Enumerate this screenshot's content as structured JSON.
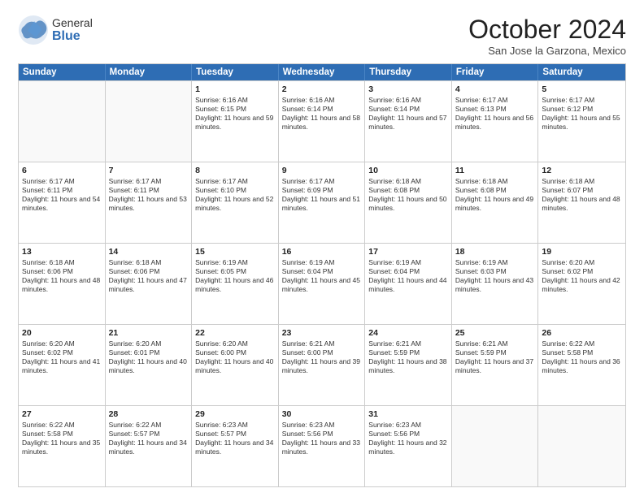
{
  "logo": {
    "general": "General",
    "blue": "Blue",
    "tagline": ""
  },
  "header": {
    "month": "October 2024",
    "location": "San Jose la Garzona, Mexico"
  },
  "days": [
    "Sunday",
    "Monday",
    "Tuesday",
    "Wednesday",
    "Thursday",
    "Friday",
    "Saturday"
  ],
  "weeks": [
    [
      {
        "day": "",
        "info": ""
      },
      {
        "day": "",
        "info": ""
      },
      {
        "day": "1",
        "info": "Sunrise: 6:16 AM\nSunset: 6:15 PM\nDaylight: 11 hours and 59 minutes."
      },
      {
        "day": "2",
        "info": "Sunrise: 6:16 AM\nSunset: 6:14 PM\nDaylight: 11 hours and 58 minutes."
      },
      {
        "day": "3",
        "info": "Sunrise: 6:16 AM\nSunset: 6:14 PM\nDaylight: 11 hours and 57 minutes."
      },
      {
        "day": "4",
        "info": "Sunrise: 6:17 AM\nSunset: 6:13 PM\nDaylight: 11 hours and 56 minutes."
      },
      {
        "day": "5",
        "info": "Sunrise: 6:17 AM\nSunset: 6:12 PM\nDaylight: 11 hours and 55 minutes."
      }
    ],
    [
      {
        "day": "6",
        "info": "Sunrise: 6:17 AM\nSunset: 6:11 PM\nDaylight: 11 hours and 54 minutes."
      },
      {
        "day": "7",
        "info": "Sunrise: 6:17 AM\nSunset: 6:11 PM\nDaylight: 11 hours and 53 minutes."
      },
      {
        "day": "8",
        "info": "Sunrise: 6:17 AM\nSunset: 6:10 PM\nDaylight: 11 hours and 52 minutes."
      },
      {
        "day": "9",
        "info": "Sunrise: 6:17 AM\nSunset: 6:09 PM\nDaylight: 11 hours and 51 minutes."
      },
      {
        "day": "10",
        "info": "Sunrise: 6:18 AM\nSunset: 6:08 PM\nDaylight: 11 hours and 50 minutes."
      },
      {
        "day": "11",
        "info": "Sunrise: 6:18 AM\nSunset: 6:08 PM\nDaylight: 11 hours and 49 minutes."
      },
      {
        "day": "12",
        "info": "Sunrise: 6:18 AM\nSunset: 6:07 PM\nDaylight: 11 hours and 48 minutes."
      }
    ],
    [
      {
        "day": "13",
        "info": "Sunrise: 6:18 AM\nSunset: 6:06 PM\nDaylight: 11 hours and 48 minutes."
      },
      {
        "day": "14",
        "info": "Sunrise: 6:18 AM\nSunset: 6:06 PM\nDaylight: 11 hours and 47 minutes."
      },
      {
        "day": "15",
        "info": "Sunrise: 6:19 AM\nSunset: 6:05 PM\nDaylight: 11 hours and 46 minutes."
      },
      {
        "day": "16",
        "info": "Sunrise: 6:19 AM\nSunset: 6:04 PM\nDaylight: 11 hours and 45 minutes."
      },
      {
        "day": "17",
        "info": "Sunrise: 6:19 AM\nSunset: 6:04 PM\nDaylight: 11 hours and 44 minutes."
      },
      {
        "day": "18",
        "info": "Sunrise: 6:19 AM\nSunset: 6:03 PM\nDaylight: 11 hours and 43 minutes."
      },
      {
        "day": "19",
        "info": "Sunrise: 6:20 AM\nSunset: 6:02 PM\nDaylight: 11 hours and 42 minutes."
      }
    ],
    [
      {
        "day": "20",
        "info": "Sunrise: 6:20 AM\nSunset: 6:02 PM\nDaylight: 11 hours and 41 minutes."
      },
      {
        "day": "21",
        "info": "Sunrise: 6:20 AM\nSunset: 6:01 PM\nDaylight: 11 hours and 40 minutes."
      },
      {
        "day": "22",
        "info": "Sunrise: 6:20 AM\nSunset: 6:00 PM\nDaylight: 11 hours and 40 minutes."
      },
      {
        "day": "23",
        "info": "Sunrise: 6:21 AM\nSunset: 6:00 PM\nDaylight: 11 hours and 39 minutes."
      },
      {
        "day": "24",
        "info": "Sunrise: 6:21 AM\nSunset: 5:59 PM\nDaylight: 11 hours and 38 minutes."
      },
      {
        "day": "25",
        "info": "Sunrise: 6:21 AM\nSunset: 5:59 PM\nDaylight: 11 hours and 37 minutes."
      },
      {
        "day": "26",
        "info": "Sunrise: 6:22 AM\nSunset: 5:58 PM\nDaylight: 11 hours and 36 minutes."
      }
    ],
    [
      {
        "day": "27",
        "info": "Sunrise: 6:22 AM\nSunset: 5:58 PM\nDaylight: 11 hours and 35 minutes."
      },
      {
        "day": "28",
        "info": "Sunrise: 6:22 AM\nSunset: 5:57 PM\nDaylight: 11 hours and 34 minutes."
      },
      {
        "day": "29",
        "info": "Sunrise: 6:23 AM\nSunset: 5:57 PM\nDaylight: 11 hours and 34 minutes."
      },
      {
        "day": "30",
        "info": "Sunrise: 6:23 AM\nSunset: 5:56 PM\nDaylight: 11 hours and 33 minutes."
      },
      {
        "day": "31",
        "info": "Sunrise: 6:23 AM\nSunset: 5:56 PM\nDaylight: 11 hours and 32 minutes."
      },
      {
        "day": "",
        "info": ""
      },
      {
        "day": "",
        "info": ""
      }
    ]
  ]
}
